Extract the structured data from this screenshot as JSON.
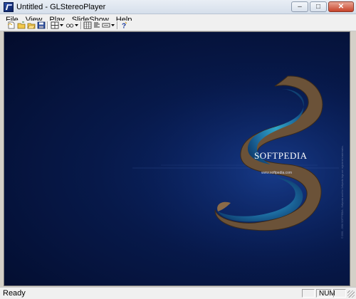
{
  "window": {
    "title": "Untitled - GLStereoPlayer"
  },
  "window_controls": {
    "minimize": "–",
    "maximize": "□",
    "close": "✕"
  },
  "menu": {
    "items": [
      "File",
      "View",
      "Play",
      "SlideShow",
      "Help"
    ]
  },
  "toolbar": {
    "buttons": [
      "new-icon",
      "open-icon",
      "open-folder-icon",
      "save-icon",
      "layout-icon",
      "dropdown-icon",
      "stereo-mode-icon",
      "dropdown-icon",
      "grid-icon",
      "align-icon",
      "display-mode-icon",
      "dropdown-icon",
      "help-icon"
    ]
  },
  "image": {
    "logo": "SOFTPEDIA",
    "url": "www.softpedia.com",
    "side_note": "© 2001 - 2008 SOFTPEDIA - Softpedia and the Softpedia logo are registered trademarks."
  },
  "status": {
    "text": "Ready",
    "num": "NUM"
  }
}
